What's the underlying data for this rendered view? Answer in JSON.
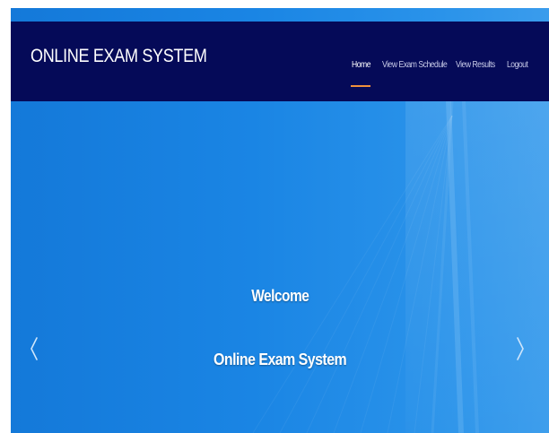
{
  "app": {
    "title": "ONLINE EXAM SYSTEM"
  },
  "nav": {
    "items": [
      {
        "label": "Home",
        "active": true
      },
      {
        "label": "View Exam Schedule",
        "active": false
      },
      {
        "label": "View Results",
        "active": false
      },
      {
        "label": "Logout",
        "active": false
      }
    ]
  },
  "hero": {
    "welcome": "Welcome",
    "subtitle": "Online Exam System",
    "prev_icon": "chevron-left-icon",
    "next_icon": "chevron-right-icon"
  },
  "colors": {
    "navbar_bg": "#050a58",
    "hero_bg": "#1e88e5",
    "active_underline": "#f0913c"
  }
}
